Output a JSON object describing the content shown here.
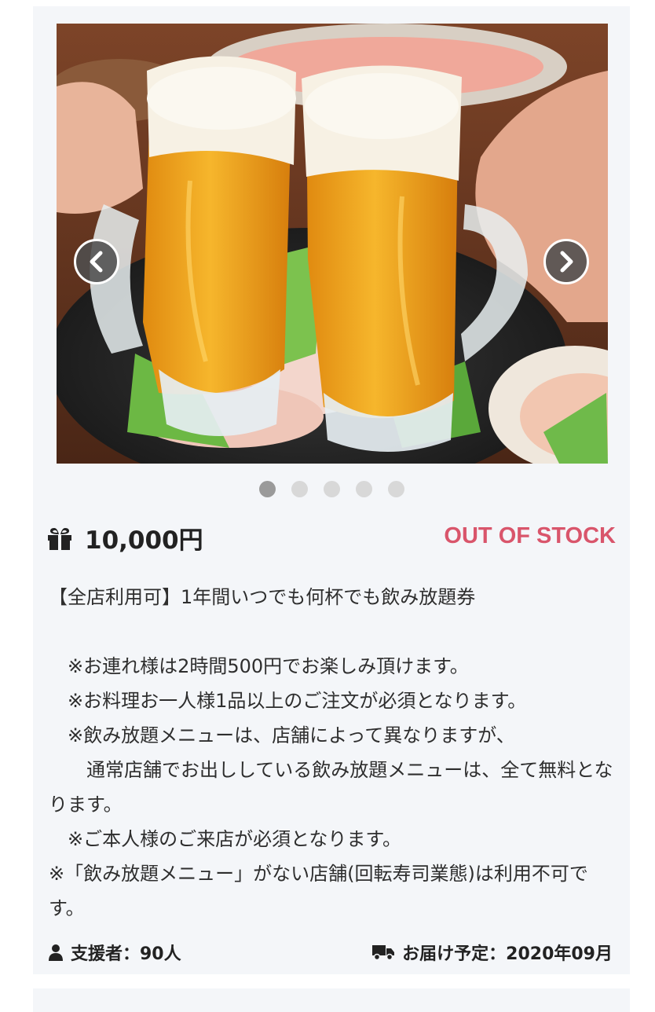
{
  "product": {
    "image": {
      "description_icon": "beer-toast-photo",
      "slides_total": 5,
      "active_slide": 1
    },
    "nav": {
      "prev_icon": "chevron-left-icon",
      "next_icon": "chevron-right-icon"
    },
    "price": "10,000円",
    "stock_status": "OUT OF STOCK",
    "stock_color": "#d9556b",
    "description": [
      "【全店利用可】1年間いつでも何杯でも飲み放題券",
      "",
      "　※お連れ様は2時間500円でお楽しみ頂けます。",
      "　※お料理お一人様1品以上のご注文が必須となります。",
      "　※飲み放題メニューは、店舗によって異なりますが、",
      "　　通常店舗でお出ししている飲み放題メニューは、全て無料となります。",
      "　※ご本人様のご来店が必須となります。",
      "※「飲み放題メニュー」がない店舗(回転寿司業態)は利用不可です。"
    ],
    "supporters_label": "支援者：90人",
    "delivery_label": "お届け予定：2020年09月"
  }
}
